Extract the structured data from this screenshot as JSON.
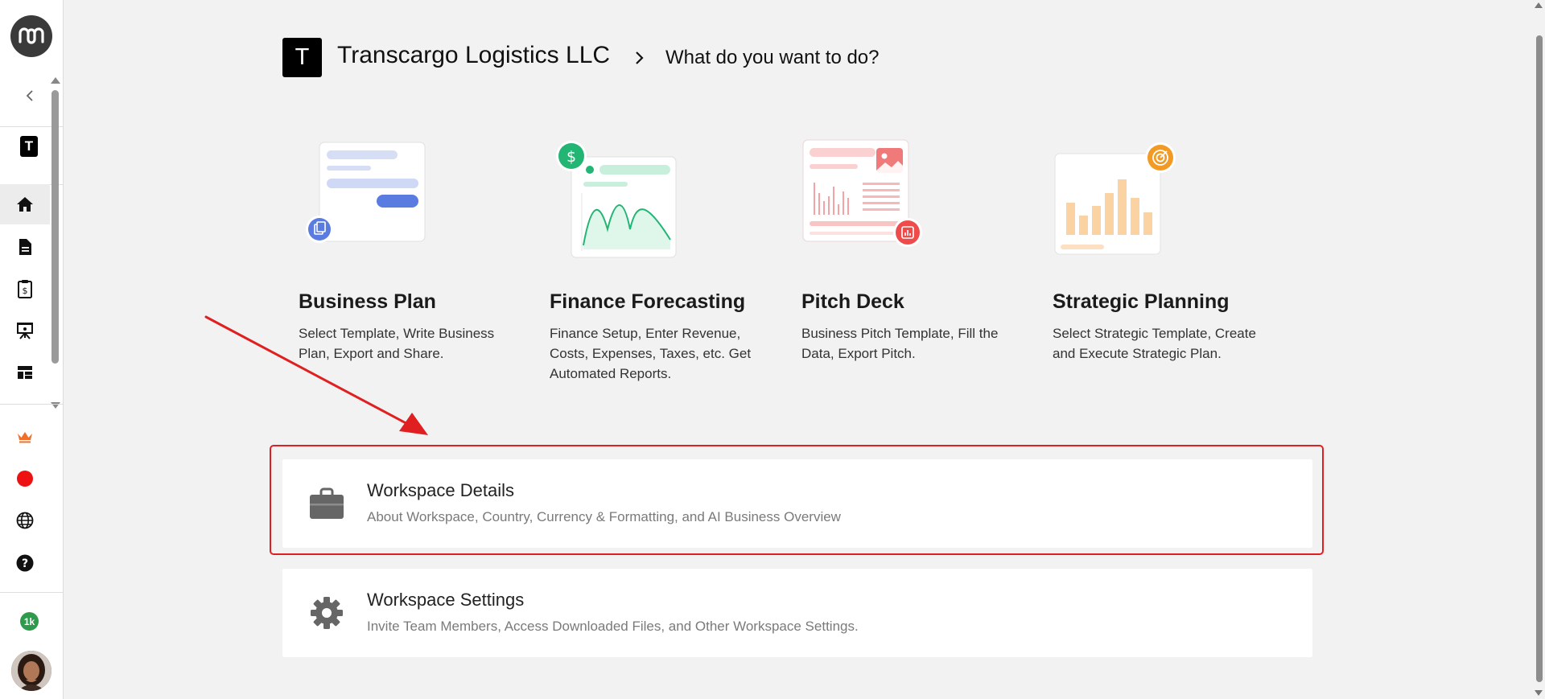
{
  "sidebar": {
    "logo_icon": "mm-logo-icon",
    "workspace_initial": "T",
    "items": [
      {
        "icon": "home-icon",
        "active": true
      },
      {
        "icon": "document-icon",
        "active": false
      },
      {
        "icon": "finance-clipboard-icon",
        "active": false
      },
      {
        "icon": "presentation-icon",
        "active": false
      },
      {
        "icon": "dashboard-icon",
        "active": false
      }
    ],
    "lower_items": [
      {
        "icon": "crown-icon"
      },
      {
        "icon": "red-dot-icon"
      },
      {
        "icon": "globe-icon"
      },
      {
        "icon": "help-icon"
      }
    ],
    "credits_badge": "1k",
    "colors": {
      "crown": "#f0702a",
      "record": "#ee1111",
      "badge": "#2e9b4c"
    }
  },
  "header": {
    "workspace_initial": "T",
    "workspace_name": "Transcargo Logistics LLC",
    "page_question": "What do you want to do?"
  },
  "cards": [
    {
      "title": "Business Plan",
      "description": "Select Template, Write Business Plan, Export and Share.",
      "icon": "business-plan-icon",
      "accent": "#5a7be0"
    },
    {
      "title": "Finance Forecasting",
      "description": "Finance Setup, Enter Revenue, Costs, Expenses, Taxes, etc. Get Automated Reports.",
      "icon": "dollar-icon",
      "accent": "#22b573"
    },
    {
      "title": "Pitch Deck",
      "description": "Business Pitch Template, Fill the Data, Export Pitch.",
      "icon": "pitch-chart-icon",
      "accent": "#ef4b4b"
    },
    {
      "title": "Strategic Planning",
      "description": "Select Strategic Template, Create and Execute Strategic Plan.",
      "icon": "target-icon",
      "accent": "#f29a24"
    }
  ],
  "options": [
    {
      "title": "Workspace Details",
      "description": "About Workspace, Country, Currency & Formatting, and AI Business Overview",
      "icon": "briefcase-icon"
    },
    {
      "title": "Workspace Settings",
      "description": "Invite Team Members, Access Downloaded Files, and Other Workspace Settings.",
      "icon": "gear-icon"
    }
  ],
  "annotation": {
    "color": "#e02020"
  }
}
